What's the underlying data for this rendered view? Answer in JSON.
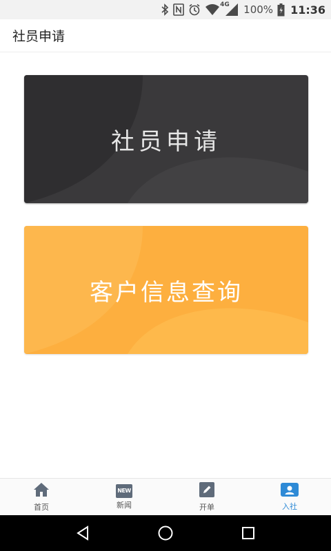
{
  "status_bar": {
    "icons": [
      "bluetooth-icon",
      "nfc-icon",
      "alarm-icon",
      "wifi-icon",
      "cell-signal-icon",
      "battery-icon"
    ],
    "network_label": "4G",
    "battery_text": "100%",
    "time": "11:36"
  },
  "header": {
    "title": "社员申请"
  },
  "cards": [
    {
      "label": "社员申请",
      "color": "#3a393b"
    },
    {
      "label": "客户信息查询",
      "color": "#fdaf3f"
    }
  ],
  "tabs": [
    {
      "label": "首页",
      "icon": "home-icon",
      "active": false
    },
    {
      "label": "新闻",
      "icon": "news-icon",
      "icon_text": "NEW",
      "active": false
    },
    {
      "label": "开单",
      "icon": "edit-icon",
      "active": false
    },
    {
      "label": "入社",
      "icon": "member-card-icon",
      "active": true
    }
  ],
  "colors": {
    "accent": "#2e8ad6",
    "tab_icon": "#5f6b7a"
  },
  "nav_bar": {
    "buttons": [
      "back-icon",
      "home-circle-icon",
      "recents-icon"
    ]
  }
}
